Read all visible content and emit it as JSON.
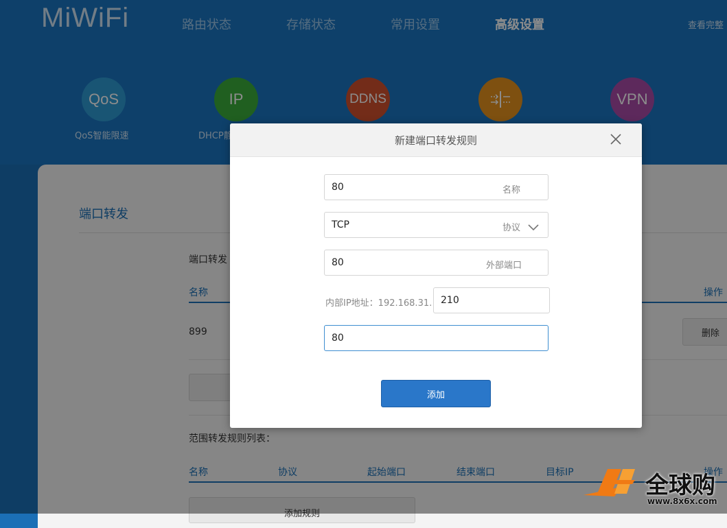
{
  "header": {
    "logo": "MiWiFi",
    "nav": [
      "路由状态",
      "存储状态",
      "常用设置",
      "高级设置"
    ],
    "right_link": "查看完整"
  },
  "features": [
    {
      "icon_text": "QoS",
      "label": "QoS智能限速",
      "color": "#2f9bd4"
    },
    {
      "icon_text": "IP",
      "label": "DHCP静",
      "color": "#3bad3b"
    },
    {
      "icon_text": "DDNS",
      "label": "",
      "color": "#d2512e"
    },
    {
      "icon_text": "",
      "label": "",
      "color": "#e6931e",
      "icon": "port-forward-icon"
    },
    {
      "icon_text": "VPN",
      "label": "",
      "color": "#a94ca8"
    }
  ],
  "panel": {
    "title": "端口转发",
    "port_list_title": "端口转发",
    "col_name": "名称",
    "col_action": "操作",
    "row_name": "899",
    "delete_label": "删除",
    "range_title": "范围转发规则列表：",
    "range_cols": [
      "名称",
      "协议",
      "起始端口",
      "结束端口",
      "目标IP",
      "操作"
    ],
    "add_rule_label": "添加规则"
  },
  "modal": {
    "title": "新建端口转发规则",
    "name_value": "80",
    "name_hint": "名称",
    "protocol_value": "TCP",
    "protocol_hint": "协议",
    "ext_port_value": "80",
    "ext_port_hint": "外部端口",
    "ip_label": "内部IP地址：192.168.31.",
    "ip_value": "210",
    "int_port_value": "80",
    "add_label": "添加"
  },
  "watermark": {
    "main": "全球购",
    "url": "www.8x6x.com"
  }
}
